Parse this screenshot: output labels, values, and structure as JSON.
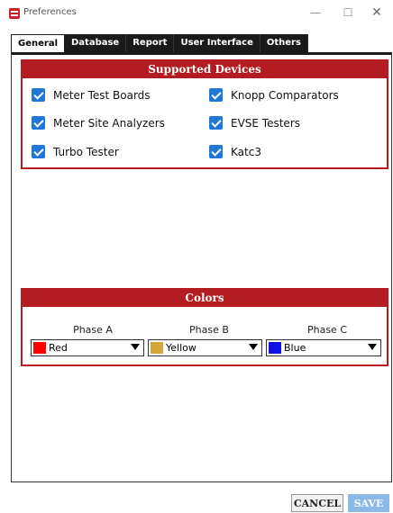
{
  "window": {
    "title": "Preferences",
    "minimize": "—",
    "maximize": "☐",
    "close": "✕"
  },
  "tabs": [
    {
      "label": "General",
      "active": true
    },
    {
      "label": "Database"
    },
    {
      "label": "Report"
    },
    {
      "label": "User Interface"
    },
    {
      "label": "Others"
    }
  ],
  "supported_devices": {
    "title": "Supported Devices",
    "items": [
      {
        "label": "Meter Test Boards",
        "checked": true
      },
      {
        "label": "Knopp Comparators",
        "checked": true
      },
      {
        "label": "Meter Site Analyzers",
        "checked": true
      },
      {
        "label": "EVSE Testers",
        "checked": true
      },
      {
        "label": "Turbo Tester",
        "checked": true
      },
      {
        "label": "Katc3",
        "checked": true
      }
    ]
  },
  "colors": {
    "title": "Colors",
    "phases": [
      {
        "label": "Phase A",
        "value": "Red",
        "swatch": "#ff0000"
      },
      {
        "label": "Phase B",
        "value": "Yellow",
        "swatch": "#d4a83a"
      },
      {
        "label": "Phase C",
        "value": "Blue",
        "swatch": "#1010e0"
      }
    ]
  },
  "buttons": {
    "cancel": "CANCEL",
    "save": "SAVE"
  },
  "theme": {
    "accent": "#b31c20",
    "checkbox": "#1f78d6"
  }
}
